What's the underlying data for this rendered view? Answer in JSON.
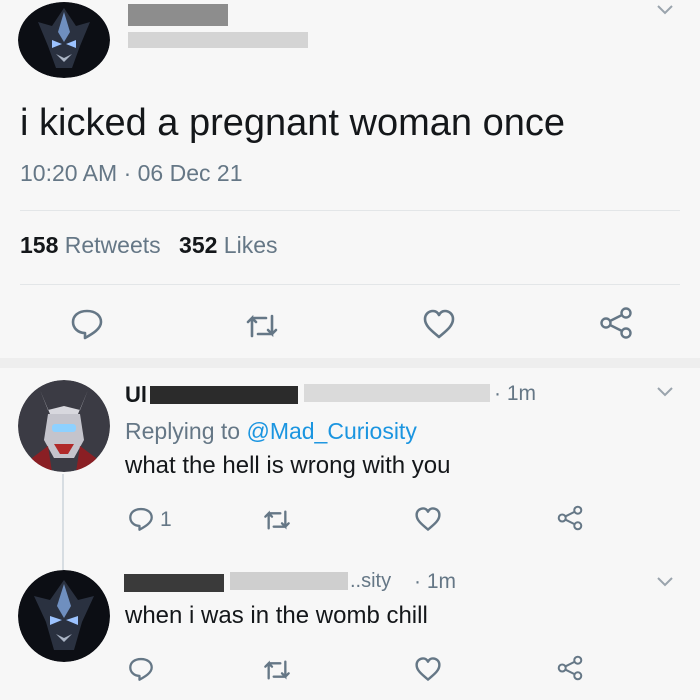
{
  "main_tweet": {
    "text": "i kicked a pregnant woman once",
    "time": "10:20 AM",
    "date_sep": "·",
    "date": "06 Dec 21",
    "retweets_count": "158",
    "retweets_label": "Retweets",
    "likes_count": "352",
    "likes_label": "Likes"
  },
  "reply1": {
    "author_fragment": "Ul",
    "time_sep": "·",
    "time": "1m",
    "replying_prefix": "Replying to",
    "replying_handle": "@Mad_Curiosity",
    "text": "what the hell is wrong with you",
    "reply_count": "1"
  },
  "reply2": {
    "handle_fragment": "..sity",
    "time_sep": "·",
    "time": "1m",
    "text": "when i was in the womb chill"
  },
  "icons": [
    "reply-icon",
    "retweet-icon",
    "like-icon",
    "share-icon",
    "chevron-down-icon"
  ],
  "colors": {
    "accent": "#1b95e0",
    "muted": "#657786",
    "text": "#14171a"
  }
}
